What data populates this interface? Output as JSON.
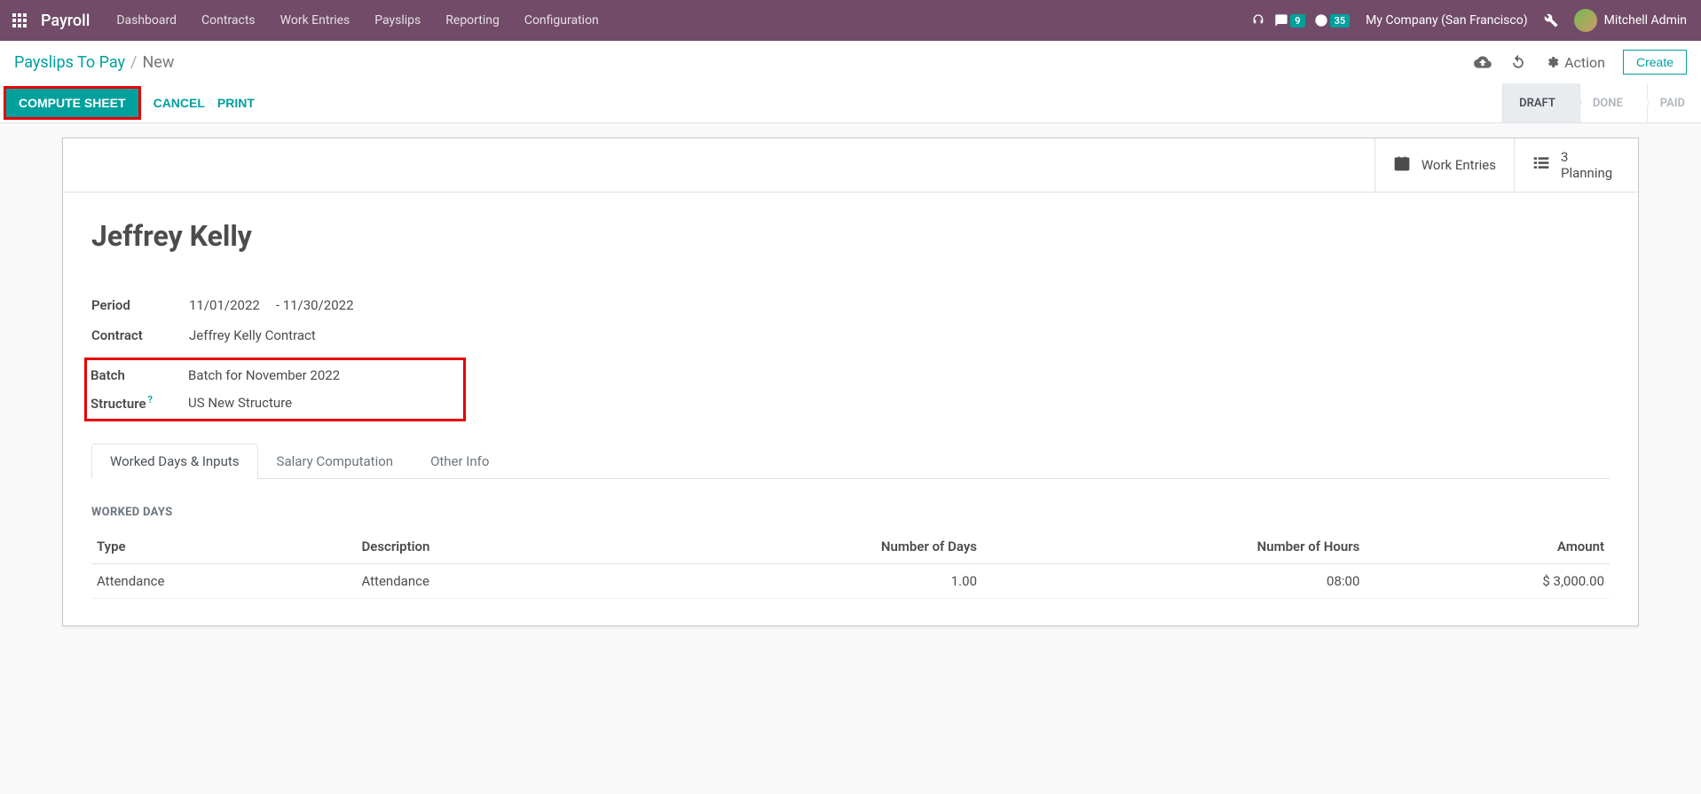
{
  "navbar": {
    "brand": "Payroll",
    "menu": [
      "Dashboard",
      "Contracts",
      "Work Entries",
      "Payslips",
      "Reporting",
      "Configuration"
    ],
    "messages_count": "9",
    "activities_count": "35",
    "company": "My Company (San Francisco)",
    "user": "Mitchell Admin"
  },
  "breadcrumb": {
    "parent": "Payslips To Pay",
    "current": "New"
  },
  "controls": {
    "action_label": "Action",
    "create_label": "Create",
    "compute_label": "Compute Sheet",
    "cancel_label": "Cancel",
    "print_label": "Print"
  },
  "status": {
    "draft": "Draft",
    "done": "Done",
    "paid": "Paid"
  },
  "stat_buttons": {
    "work_entries": "Work Entries",
    "planning_count": "3",
    "planning": "Planning"
  },
  "record": {
    "title": "Jeffrey Kelly",
    "labels": {
      "period": "Period",
      "contract": "Contract",
      "batch": "Batch",
      "structure": "Structure"
    },
    "period_from": "11/01/2022",
    "period_to": "- 11/30/2022",
    "contract": "Jeffrey Kelly Contract",
    "batch": "Batch for November 2022",
    "structure": "US New Structure"
  },
  "tabs": {
    "worked": "Worked Days & Inputs",
    "salary": "Salary Computation",
    "other": "Other Info"
  },
  "worked_days": {
    "section": "Worked Days",
    "headers": {
      "type": "Type",
      "description": "Description",
      "days": "Number of Days",
      "hours": "Number of Hours",
      "amount": "Amount"
    },
    "rows": [
      {
        "type": "Attendance",
        "description": "Attendance",
        "days": "1.00",
        "hours": "08:00",
        "amount": "$ 3,000.00"
      }
    ]
  }
}
